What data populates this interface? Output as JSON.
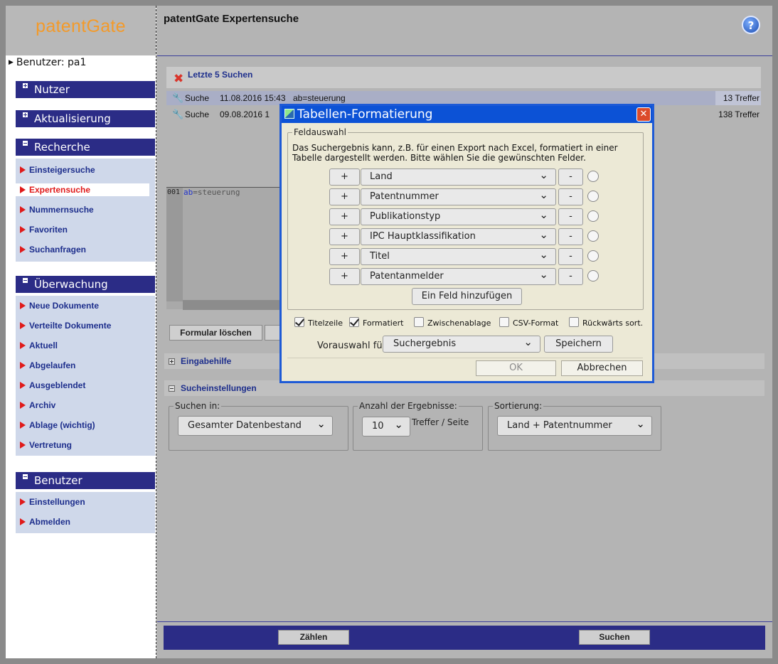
{
  "sidebar": {
    "logo": "patentGate",
    "user_line": "Benutzer: pa1",
    "sections": {
      "nutzer": "Nutzer",
      "aktualisierung": "Aktualisierung",
      "recherche": "Recherche",
      "ueberwachung": "Überwachung",
      "benutzer": "Benutzer"
    },
    "recherche_items": [
      "Einsteigersuche",
      "Expertensuche",
      "Nummernsuche",
      "Favoriten",
      "Suchanfragen"
    ],
    "ueberwachung_items": [
      "Neue Dokumente",
      "Verteilte Dokumente",
      "Aktuell",
      "Abgelaufen",
      "Ausgeblendet",
      "Archiv",
      "Ablage (wichtig)",
      "Vertretung"
    ],
    "benutzer_items": [
      "Einstellungen",
      "Abmelden"
    ]
  },
  "main": {
    "title": "patentGate Expertensuche",
    "help_icon": "help-icon",
    "recent": {
      "title": "Letzte 5 Suchen",
      "rows": [
        {
          "label": "Suche",
          "date": "11.08.2016 15:43",
          "query": "ab=steuerung",
          "hits": "13 Treffer"
        },
        {
          "label": "Suche",
          "date": "09.08.2016 1",
          "query": "",
          "hits": "138 Treffer"
        }
      ]
    },
    "editor": {
      "line_no": "001",
      "code_kw": "ab",
      "code_rest": "=steuerung"
    },
    "clear_button": "Formular löschen",
    "input_help": "Eingabehilfe",
    "settings": {
      "title": "Sucheinstellungen",
      "search_in_legend": "Suchen in:",
      "search_in_value": "Gesamter Datenbestand",
      "count_legend": "Anzahl der Ergebnisse:",
      "count_value": "10",
      "count_unit": "Treffer / Seite",
      "sort_legend": "Sortierung:",
      "sort_value": "Land + Patentnummer"
    },
    "footer": {
      "count_button": "Zählen",
      "search_button": "Suchen"
    }
  },
  "dialog": {
    "title": "Tabellen-Formatierung",
    "fieldset_legend": "Feldauswahl",
    "description": "Das Suchergebnis kann, z.B. für einen Export nach Excel, formatiert in einer Tabelle dargestellt werden. Bitte wählen Sie die gewünschten Felder.",
    "plus_label": "+",
    "minus_label": "-",
    "fields": [
      "Land",
      "Patentnummer",
      "Publikationstyp",
      "IPC Hauptklassifikation",
      "Titel",
      "Patentanmelder"
    ],
    "add_field_button": "Ein Feld hinzufügen",
    "checkboxes": [
      {
        "label": "Titelzeile",
        "checked": true
      },
      {
        "label": "Formatiert",
        "checked": true
      },
      {
        "label": "Zwischenablage",
        "checked": false
      },
      {
        "label": "CSV-Format",
        "checked": false
      },
      {
        "label": "Rückwärts sort.",
        "checked": false
      }
    ],
    "preselect_label": "Vorauswahl für:",
    "preselect_value": "Suchergebnis",
    "save_button": "Speichern",
    "ok_button": "OK",
    "cancel_button": "Abbrechen"
  },
  "colors": {
    "nav_blue": "#2b2c86",
    "link_blue": "#1d2e8c",
    "link_red": "#e01a1a",
    "logo_orange": "#f39a2a",
    "dialog_title_blue": "#0c52d6"
  }
}
